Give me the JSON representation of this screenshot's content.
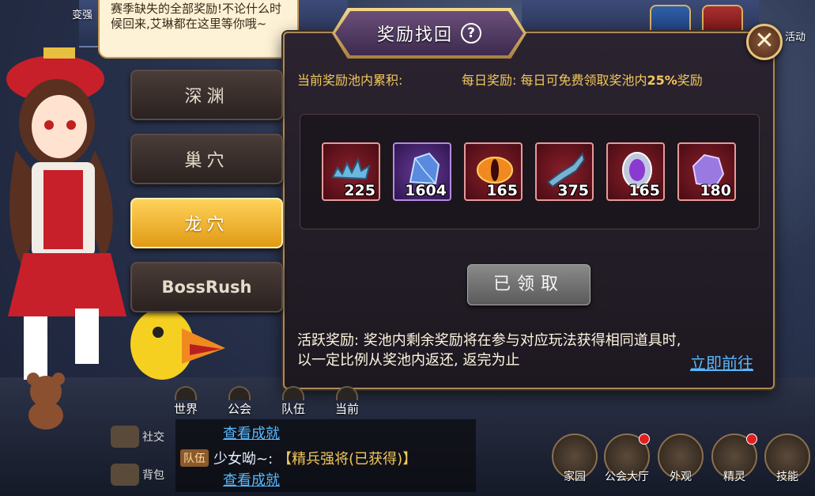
{
  "top": {
    "left_button_label": "变强",
    "right_label": "活动"
  },
  "npc_bubble": {
    "text": "赛季缺失的全部奖励!不论什么时候回来,艾琳都在这里等你哦~"
  },
  "dialog": {
    "title": "奖励找回",
    "help_symbol": "?",
    "close_symbol": "✕"
  },
  "tabs": [
    {
      "label": "深渊",
      "active": false
    },
    {
      "label": "巢穴",
      "active": false
    },
    {
      "label": "龙穴",
      "active": true
    },
    {
      "label": "BossRush",
      "active": false
    }
  ],
  "pool": {
    "accumulated_label": "当前奖励池内累积:",
    "daily_reward_prefix": "每日奖励: 每日可免费领取奖池内",
    "daily_reward_percent": "25%",
    "daily_reward_suffix": "奖励"
  },
  "items": [
    {
      "icon": "blue-fang-icon",
      "count": "225",
      "rarity": "red"
    },
    {
      "icon": "crystal-shard-icon",
      "count": "1604",
      "rarity": "purple"
    },
    {
      "icon": "dragon-eye-icon",
      "count": "165",
      "rarity": "red"
    },
    {
      "icon": "dragon-bone-icon",
      "count": "375",
      "rarity": "red"
    },
    {
      "icon": "purple-gem-icon",
      "count": "165",
      "rarity": "red"
    },
    {
      "icon": "purple-ore-icon",
      "count": "180",
      "rarity": "red"
    }
  ],
  "claim_button": {
    "label": "已领取",
    "state": "disabled"
  },
  "description": "活跃奖励: 奖池内剩余奖励将在参与对应玩法获得相同道具时, 以一定比例从奖池内返还, 返完为止",
  "go_link": "立即前往",
  "chat": {
    "tabs": [
      "世界",
      "公会",
      "队伍",
      "当前"
    ],
    "link_1": "查看成就",
    "team_tag": "队伍",
    "sender": "少女呦~:",
    "item_text": "【精兵强将(已获得)】",
    "link_2": "查看成就",
    "social_label": "社交",
    "bag_label": "背包"
  },
  "bottom_menu": [
    {
      "label": "家园",
      "badge": false
    },
    {
      "label": "公会大厅",
      "badge": true
    },
    {
      "label": "外观",
      "badge": false
    },
    {
      "label": "精灵",
      "badge": true
    },
    {
      "label": "技能",
      "badge": false
    }
  ],
  "colors": {
    "accent_gold": "#f2c85a",
    "link_blue": "#58b8ff",
    "active_tab": "#ffd25a"
  }
}
